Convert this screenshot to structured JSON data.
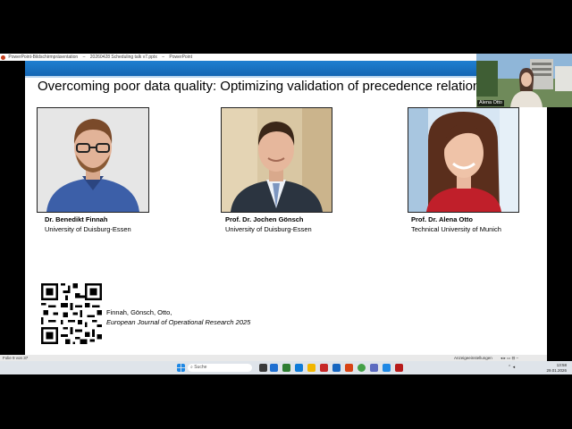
{
  "window": {
    "titlebar_items": [
      "PowerPoint-Bildschirmpräsentation",
      "–",
      "20260428 Scheduling talk v7.pptx",
      "–",
      "PowerPoint"
    ]
  },
  "slide": {
    "title": "Overcoming poor data quality: Optimizing validation of precedence relation d",
    "people": [
      {
        "name": "Dr. Benedikt Finnah",
        "affiliation": "University of Duisburg-Essen"
      },
      {
        "name": "Prof. Dr. Jochen Gönsch",
        "affiliation": "University of Duisburg-Essen"
      },
      {
        "name": "Prof. Dr. Alena Otto",
        "affiliation": "Technical University of Munich"
      }
    ],
    "citation": {
      "authors": "Finnah, Gönsch, Otto,",
      "journal": "European Journal of Operational Research 2025"
    }
  },
  "webcam": {
    "name": "Alena Otto"
  },
  "statusbar": {
    "slide_info": "Folie 9 von 37",
    "notes_label": "Anzeigeeinstellungen",
    "controls": "◂  ▸  ▭  ⊟  –"
  },
  "taskbar": {
    "search_placeholder": "Suche",
    "time": "13:58",
    "date": "29.01.2026",
    "tray_arrows": "⌃  ◂"
  },
  "colors": {
    "accent": "#1466b3",
    "powerpoint": "#c43e1c"
  }
}
